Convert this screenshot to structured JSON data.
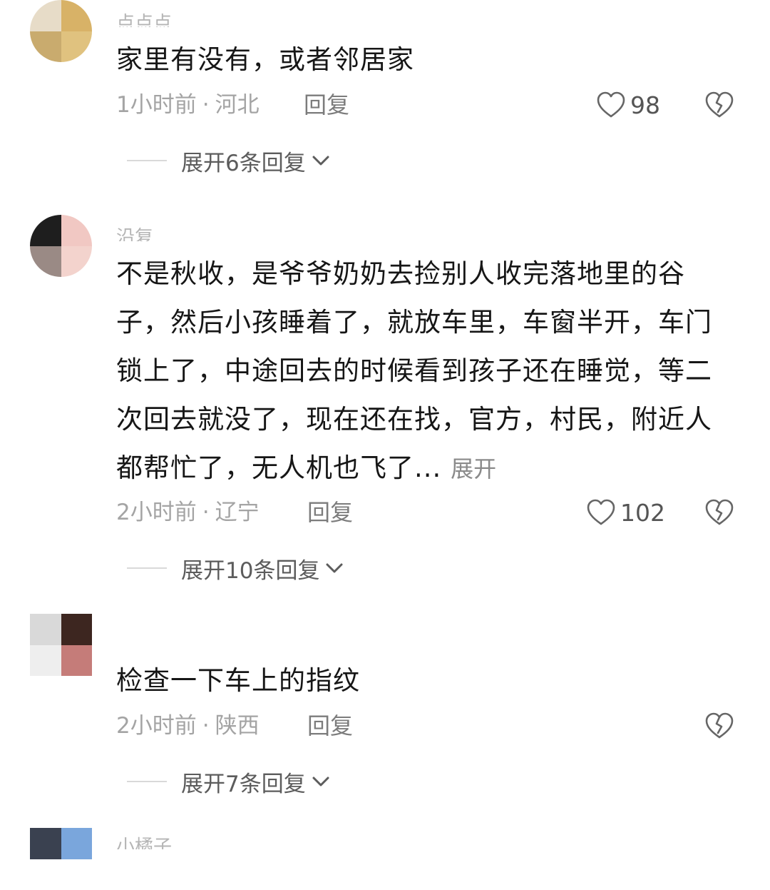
{
  "comments": [
    {
      "username": "点点点",
      "text": "家里有没有，或者邻居家",
      "time": "1小时前",
      "location": "河北",
      "reply_label": "回复",
      "likes": "98",
      "expand_label": "展开6条回复",
      "avatar_colors": [
        "#e7dcc8",
        "#d8b267",
        "#c9ab6e",
        "#e0c27f"
      ]
    },
    {
      "username": "沿复",
      "text": "不是秋收，是爷爷奶奶去捡别人收完落地里的谷子，然后小孩睡着了，就放车里，车窗半开，车门锁上了，中途回去的时候看到孩子还在睡觉，等二次回去就没了，现在还在找，官方，村民，附近人都帮忙了，无人机也飞了...",
      "more_label": "展开",
      "time": "2小时前",
      "location": "辽宁",
      "reply_label": "回复",
      "likes": "102",
      "expand_label": "展开10条回复",
      "avatar_colors": [
        "#1e1e1e",
        "#f1c8c3",
        "#9a8a85",
        "#f3d3cd"
      ]
    },
    {
      "username": "",
      "text": "检查一下车上的指纹",
      "time": "2小时前",
      "location": "陕西",
      "reply_label": "回复",
      "likes": "",
      "expand_label": "展开7条回复",
      "avatar_colors": [
        "#d9d9d9",
        "#3d2620",
        "#eeeeee",
        "#c57c79"
      ]
    },
    {
      "username": "小橘子",
      "avatar_colors": [
        "#3a4150",
        "#7aa6dc",
        "#5b6170",
        "#8cb5e6"
      ]
    }
  ],
  "icons": {
    "like": "heart-outline-icon",
    "dislike": "broken-heart-icon",
    "expand": "chevron-down-icon"
  }
}
